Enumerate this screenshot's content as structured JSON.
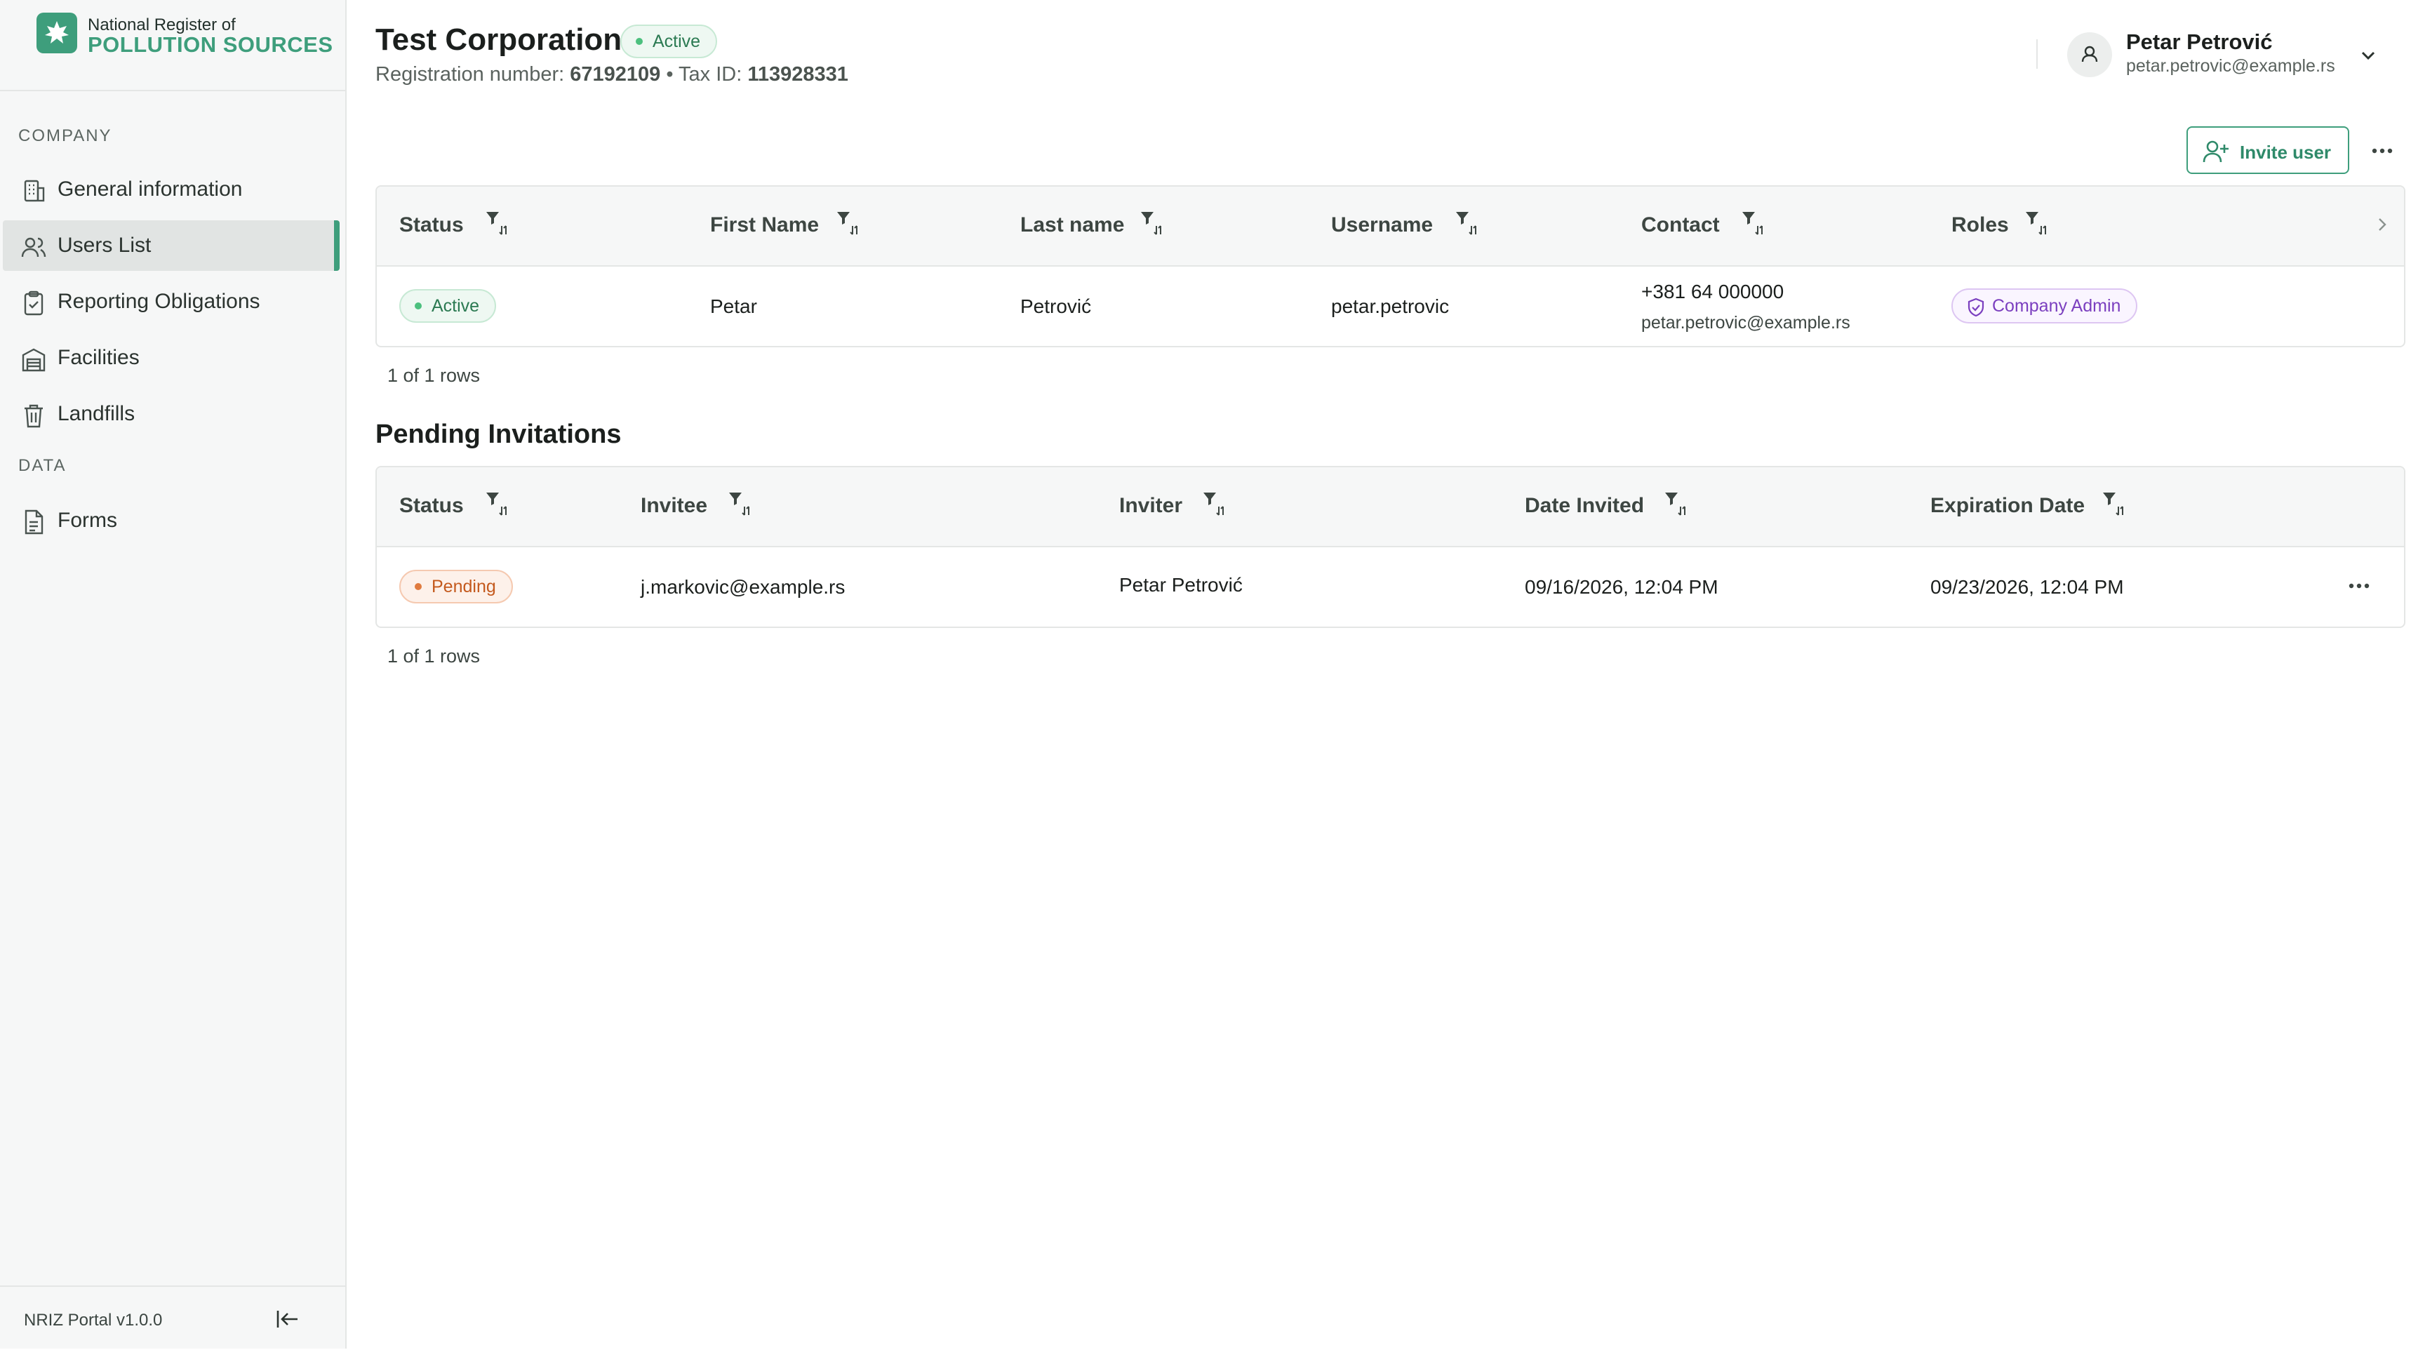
{
  "brand": {
    "line1": "National Register of",
    "line2": "POLLUTION SOURCES"
  },
  "sidebar": {
    "sections": [
      {
        "title": "COMPANY"
      },
      {
        "title": "DATA"
      }
    ],
    "items": [
      {
        "label": "General information",
        "icon": "building-icon"
      },
      {
        "label": "Users List",
        "icon": "users-icon",
        "active": true
      },
      {
        "label": "Reporting Obligations",
        "icon": "clipboard-check-icon"
      },
      {
        "label": "Facilities",
        "icon": "warehouse-icon"
      },
      {
        "label": "Landfills",
        "icon": "trash-icon"
      },
      {
        "label": "Forms",
        "icon": "document-icon"
      }
    ],
    "version": "NRIZ Portal v1.0.0"
  },
  "header": {
    "company_name": "Test Corporation",
    "status": "Active",
    "reg_label": "Registration number:",
    "reg_value": "67192109",
    "separator": "•",
    "tax_label": "Tax ID:",
    "tax_value": "113928331"
  },
  "user": {
    "name": "Petar Petrović",
    "email": "petar.petrovic@example.rs"
  },
  "actions": {
    "invite_label": "Invite user"
  },
  "users_table": {
    "columns": [
      "Status",
      "First Name",
      "Last name",
      "Username",
      "Contact",
      "Roles"
    ],
    "rows": [
      {
        "status": "Active",
        "first_name": "Petar",
        "last_name": "Petrović",
        "username": "petar.petrovic",
        "phone": "+381 64 000000",
        "email": "petar.petrovic@example.rs",
        "role": "Company Admin"
      }
    ],
    "rows_count": "1 of 1 rows"
  },
  "invitations": {
    "title": "Pending Invitations",
    "columns": [
      "Status",
      "Invitee",
      "Inviter",
      "Date Invited",
      "Expiration Date"
    ],
    "rows": [
      {
        "status": "Pending",
        "invitee": "j.markovic@example.rs",
        "inviter": "Petar Petrović",
        "date_invited": "09/16/2026, 12:04 PM",
        "expiration_date": "09/23/2026, 12:04 PM"
      }
    ],
    "rows_count": "1 of 1 rows"
  },
  "colors": {
    "accent": "#3e9e7c",
    "active_badge": "#2b7a52",
    "pending_badge": "#c45a1e",
    "role_badge": "#7b3fbf"
  }
}
